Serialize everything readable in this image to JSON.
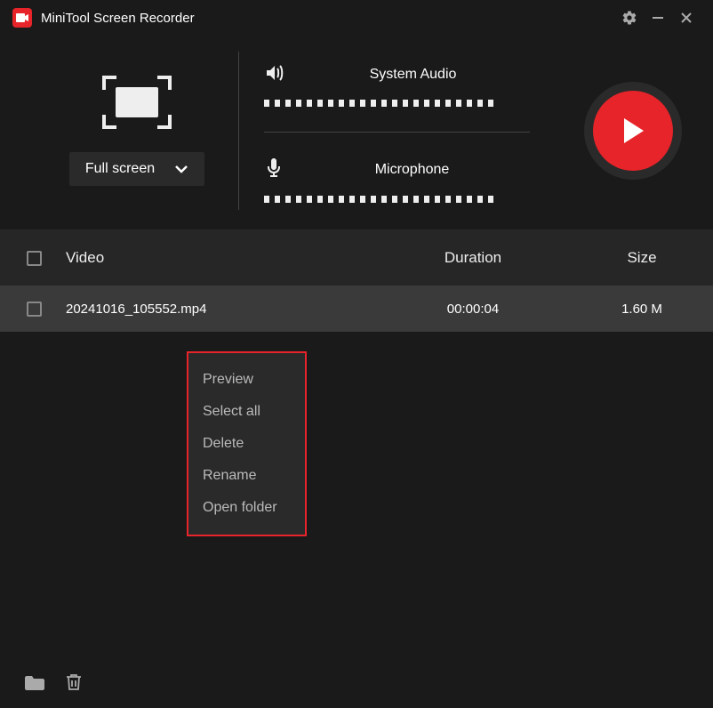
{
  "titlebar": {
    "app_name": "MiniTool Screen Recorder"
  },
  "controls": {
    "fullscreen_label": "Full screen",
    "system_audio_label": "System Audio",
    "microphone_label": "Microphone"
  },
  "table": {
    "headers": {
      "video": "Video",
      "duration": "Duration",
      "size": "Size"
    },
    "rows": [
      {
        "filename": "20241016_105552.mp4",
        "duration": "00:00:04",
        "size": "1.60 M"
      }
    ]
  },
  "context_menu": {
    "preview": "Preview",
    "select_all": "Select all",
    "delete": "Delete",
    "rename": "Rename",
    "open_folder": "Open folder"
  }
}
